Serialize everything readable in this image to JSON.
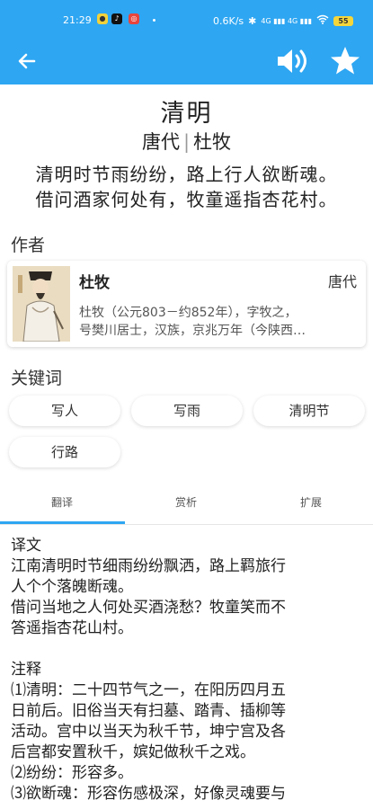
{
  "status_bar": {
    "time": "21:29",
    "net_speed": "0.6K/s",
    "bluetooth": "✱",
    "signal": "4G ▮▮▮ 4G ▮▮▮",
    "battery": "55"
  },
  "icons": {
    "back": "arrow-left",
    "speaker": "volume",
    "favorite": "star"
  },
  "poem": {
    "title": "清明",
    "dynasty": "唐代",
    "separator": "|",
    "author": "杜牧",
    "lines": [
      "清明时节雨纷纷，路上行人欲断魂。",
      "借问酒家何处有，牧童遥指杏花村。"
    ]
  },
  "sections": {
    "author_heading": "作者",
    "keywords_heading": "关键词"
  },
  "author_card": {
    "name": "杜牧",
    "dynasty": "唐代",
    "bio_line1": "杜牧（公元803－约852年），字牧之，",
    "bio_line2": "号樊川居士，汉族，京兆万年（今陕西…"
  },
  "keywords": [
    "写人",
    "写雨",
    "清明节",
    "行路"
  ],
  "tabs": [
    {
      "label": "翻译"
    },
    {
      "label": "赏析"
    },
    {
      "label": "扩展"
    }
  ],
  "translation": {
    "heading": "译文",
    "lines": [
      "江南清明时节细雨纷纷飘洒，路上羁旅行",
      "人个个落魄断魂。",
      "借问当地之人何处买酒浇愁？牧童笑而不",
      "答遥指杏花山村。"
    ]
  },
  "notes": {
    "heading": "注释",
    "lines": [
      "⑴清明：二十四节气之一，在阳历四月五",
      "日前后。旧俗当天有扫墓、踏青、插柳等",
      "活动。宫中以当天为秋千节，坤宁宫及各",
      "后宫都安置秋千，嫔妃做秋千之戏。",
      "⑵纷纷：形容多。",
      "⑶欲断魂：形容伤感极深，好像灵魂要与"
    ]
  },
  "colors": {
    "accent": "#2ea6f2",
    "battery": "#f5d63a"
  }
}
